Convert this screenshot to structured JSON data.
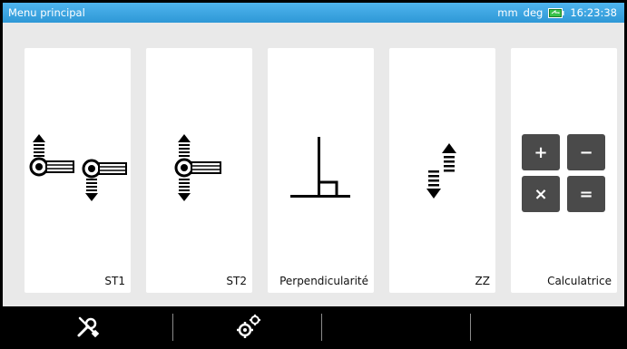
{
  "statusbar": {
    "title": "Menu principal",
    "units": "mm",
    "angle_unit": "deg",
    "battery_icon": "battery-icon",
    "time": "16:23:38",
    "color": "#3aa6e2"
  },
  "tiles": [
    {
      "label": "ST1",
      "icon": "st1-shaft-alignment-icon"
    },
    {
      "label": "ST2",
      "icon": "st2-shaft-alignment-icon"
    },
    {
      "label": "Perpendicularité",
      "icon": "perpendicularity-icon"
    },
    {
      "label": "ZZ",
      "icon": "zz-updown-icon"
    },
    {
      "label": "Calculatrice",
      "icon": "calculator-icon",
      "keys": [
        "+",
        "−",
        "×",
        "="
      ]
    }
  ],
  "bottombar": {
    "items": [
      {
        "icon": "tools-icon"
      },
      {
        "icon": "settings-gears-icon"
      }
    ]
  }
}
